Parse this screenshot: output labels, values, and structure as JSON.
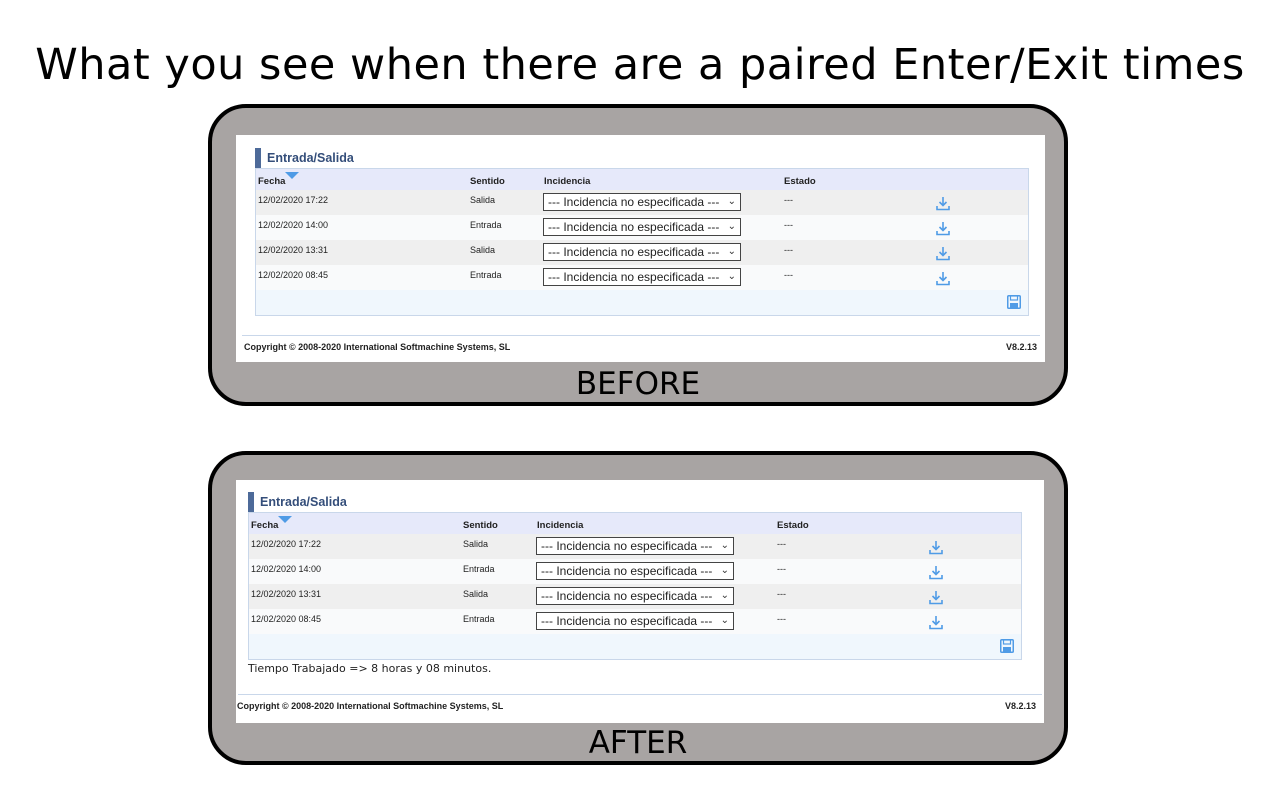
{
  "headline": "What you see when there are a paired Enter/Exit times",
  "colors": {
    "accent": "#4d6a99",
    "header_bg": "#e6e9fa",
    "icon": "#4f9be6",
    "frame": "#a8a4a3"
  },
  "before": {
    "label": "BEFORE",
    "section_title": "Entrada/Salida",
    "columns": {
      "fecha": "Fecha",
      "sentido": "Sentido",
      "incidencia": "Incidencia",
      "estado": "Estado"
    },
    "rows": [
      {
        "fecha": "12/02/2020 17:22",
        "sentido": "Salida",
        "incidencia": "--- Incidencia no especificada ---",
        "estado": "---"
      },
      {
        "fecha": "12/02/2020 14:00",
        "sentido": "Entrada",
        "incidencia": "--- Incidencia no especificada ---",
        "estado": "---"
      },
      {
        "fecha": "12/02/2020 13:31",
        "sentido": "Salida",
        "incidencia": "--- Incidencia no especificada ---",
        "estado": "---"
      },
      {
        "fecha": "12/02/2020 08:45",
        "sentido": "Entrada",
        "incidencia": "--- Incidencia no especificada ---",
        "estado": "---"
      }
    ],
    "copyright": "Copyright © 2008-2020 International Softmachine Systems, SL",
    "version": "V8.2.13"
  },
  "after": {
    "label": "AFTER",
    "section_title": "Entrada/Salida",
    "columns": {
      "fecha": "Fecha",
      "sentido": "Sentido",
      "incidencia": "Incidencia",
      "estado": "Estado"
    },
    "rows": [
      {
        "fecha": "12/02/2020 17:22",
        "sentido": "Salida",
        "incidencia": "--- Incidencia no especificada ---",
        "estado": "---"
      },
      {
        "fecha": "12/02/2020 14:00",
        "sentido": "Entrada",
        "incidencia": "--- Incidencia no especificada ---",
        "estado": "---"
      },
      {
        "fecha": "12/02/2020 13:31",
        "sentido": "Salida",
        "incidencia": "--- Incidencia no especificada ---",
        "estado": "---"
      },
      {
        "fecha": "12/02/2020 08:45",
        "sentido": "Entrada",
        "incidencia": "--- Incidencia no especificada ---",
        "estado": "---"
      }
    ],
    "worked_time": "Tiempo Trabajado => 8 horas y 08 minutos.",
    "copyright": "Copyright © 2008-2020 International Softmachine Systems, SL",
    "version": "V8.2.13"
  }
}
